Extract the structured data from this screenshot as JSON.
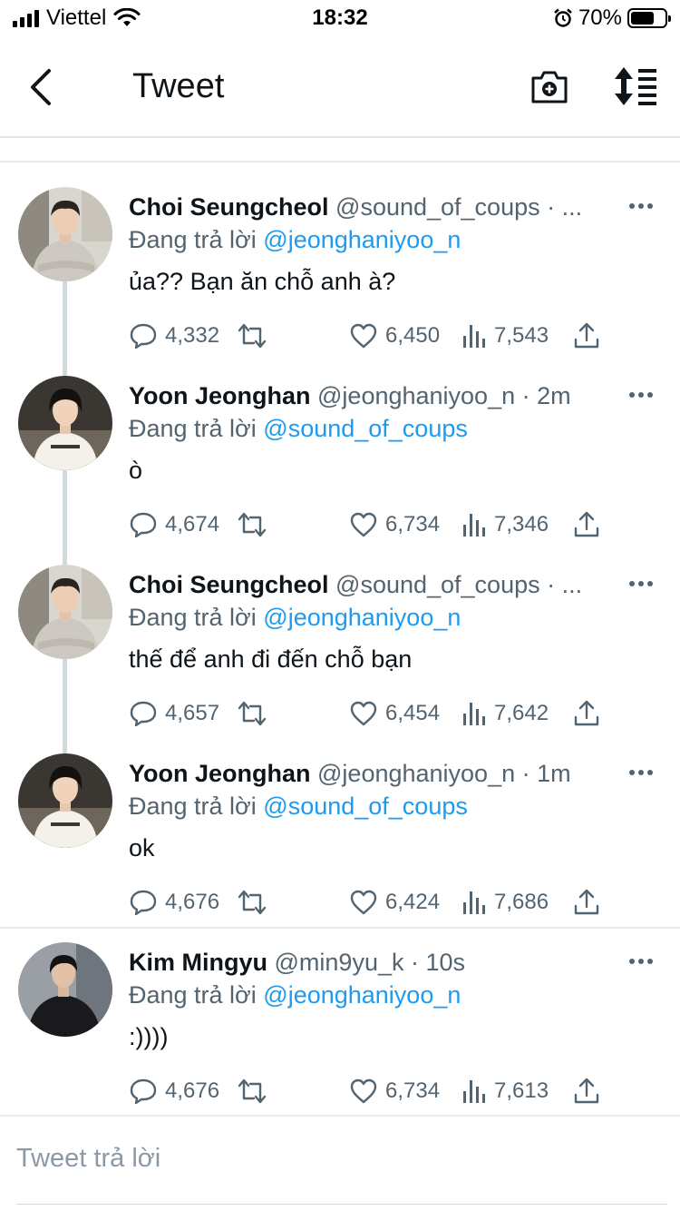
{
  "status_bar": {
    "carrier": "Viettel",
    "time": "18:32",
    "battery_percent": "70%",
    "battery_level": 0.7
  },
  "header": {
    "title": "Tweet",
    "back_icon": "chevron-left-icon",
    "camera_icon": "camera-plus-icon",
    "sort_icon": "sort-icon"
  },
  "colors": {
    "accent": "#1d9bf0",
    "text": "#0f1419",
    "muted": "#536471",
    "thread_line": "#cfd9de"
  },
  "tweets": [
    {
      "name": "Choi Seungcheol",
      "handle": "@sound_of_coups · ...",
      "replying_prefix": "Đang trả lời",
      "replying_to": "@jeonghaniyoo_n",
      "text": "ủa?? Bạn ăn chỗ anh à?",
      "replies": "4,332",
      "likes": "6,450",
      "views": "7,543",
      "avatar": "scoups"
    },
    {
      "name": "Yoon Jeonghan",
      "handle": "@jeonghaniyoo_n · 2m",
      "replying_prefix": "Đang trả lời",
      "replying_to": "@sound_of_coups",
      "text": "ò",
      "replies": "4,674",
      "likes": "6,734",
      "views": "7,346",
      "avatar": "jeonghan"
    },
    {
      "name": "Choi Seungcheol",
      "handle": "@sound_of_coups · ...",
      "replying_prefix": "Đang trả lời",
      "replying_to": "@jeonghaniyoo_n",
      "text": "thế để anh đi đến chỗ bạn",
      "replies": "4,657",
      "likes": "6,454",
      "views": "7,642",
      "avatar": "scoups"
    },
    {
      "name": "Yoon Jeonghan",
      "handle": "@jeonghaniyoo_n · 1m",
      "replying_prefix": "Đang trả lời",
      "replying_to": "@sound_of_coups",
      "text": "ok",
      "replies": "4,676",
      "likes": "6,424",
      "views": "7,686",
      "avatar": "jeonghan"
    },
    {
      "name": "Kim Mingyu",
      "handle": "@min9yu_k · 10s",
      "replying_prefix": "Đang trả lời",
      "replying_to": "@jeonghaniyoo_n",
      "text": ":))))",
      "replies": "4,676",
      "likes": "6,734",
      "views": "7,613",
      "avatar": "mingyu"
    }
  ],
  "compose": {
    "placeholder": "Tweet trả lời"
  }
}
